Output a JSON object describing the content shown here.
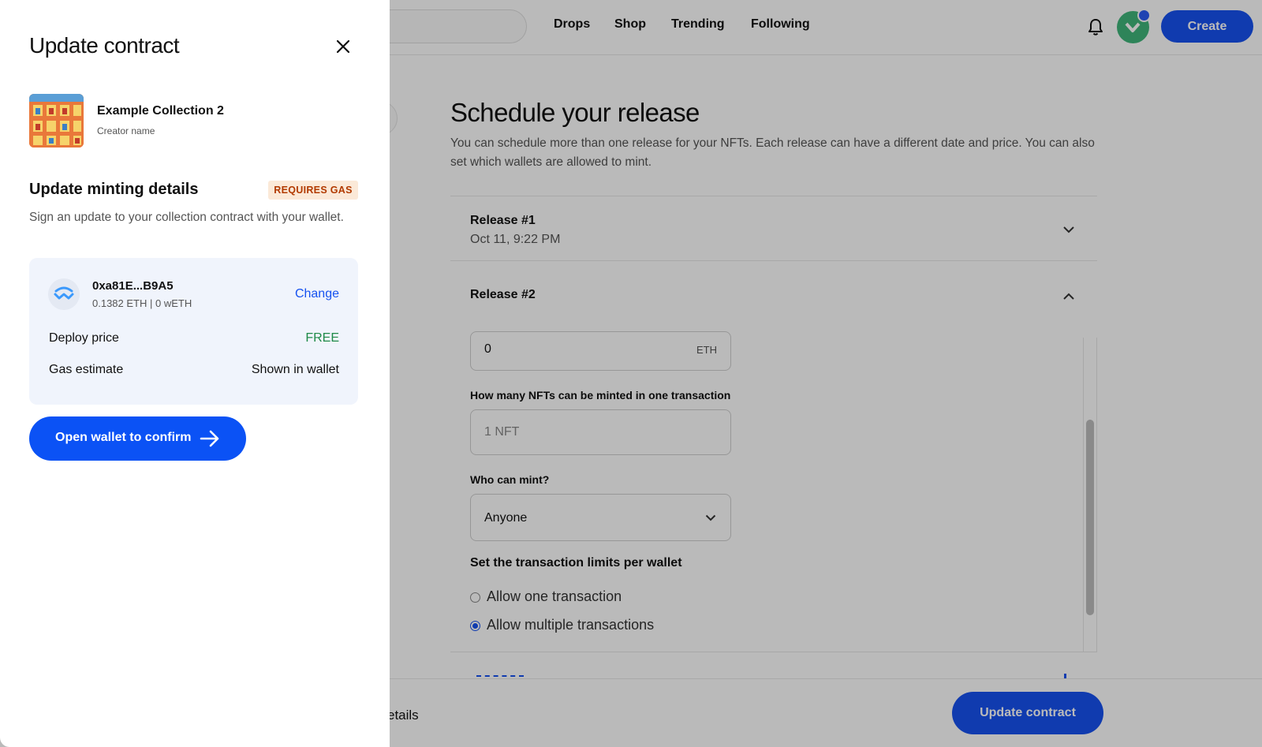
{
  "topbar": {
    "nav": [
      "Drops",
      "Shop",
      "Trending",
      "Following"
    ],
    "create_label": "Create"
  },
  "main": {
    "title": "Schedule your release",
    "description": "You can schedule more than one release for your NFTs. Each release can have a different date and price. You can also set which wallets are allowed to mint.",
    "releases": [
      {
        "title": "Release #1",
        "date": "Oct 11, 9:22 PM",
        "expanded": false
      },
      {
        "title": "Release #2",
        "expanded": true
      }
    ],
    "price_value": "0",
    "price_unit": "ETH",
    "per_tx_label": "How many NFTs can be minted in one transaction",
    "per_tx_placeholder": "1 NFT",
    "who_label": "Who can mint?",
    "who_value": "Anyone",
    "limits_label": "Set the transaction limits per wallet",
    "limit_options": [
      {
        "label": "Allow one transaction",
        "selected": false
      },
      {
        "label": "Allow multiple transactions",
        "selected": true
      }
    ]
  },
  "bottombar": {
    "left_text": "etails",
    "update_label": "Update contract"
  },
  "drawer": {
    "title": "Update contract",
    "collection": {
      "name": "Example Collection 2",
      "creator": "Creator name"
    },
    "section_title": "Update minting details",
    "gas_badge": "REQUIRES GAS",
    "section_desc": "Sign an update to your collection contract with your wallet.",
    "wallet": {
      "address": "0xa81E...B9A5",
      "balance": "0.1382 ETH | 0 wETH",
      "change_label": "Change",
      "deploy_label": "Deploy price",
      "deploy_value": "FREE",
      "gas_label": "Gas estimate",
      "gas_value": "Shown in wallet"
    },
    "confirm_label": "Open wallet to confirm"
  },
  "colors": {
    "accent": "#1652f0",
    "free": "#1f8a48",
    "gas_badge_bg": "#fbe9d8",
    "gas_badge_text": "#b23a00",
    "avatar": "#3fb67b"
  }
}
